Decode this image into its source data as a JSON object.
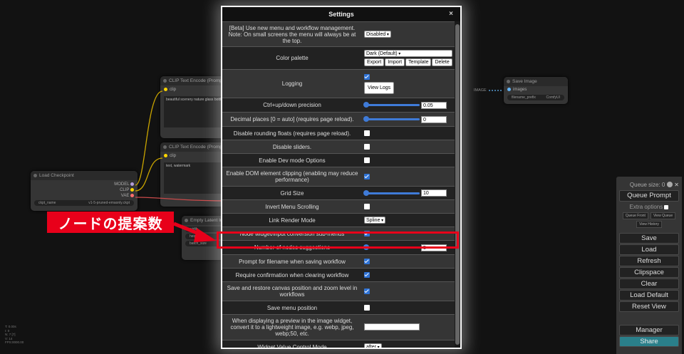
{
  "modal": {
    "title": "Settings",
    "close": "×"
  },
  "settings": [
    {
      "label": "[Beta] Use new menu and workflow management. Note: On small screens the menu will always be at the top.",
      "type": "select",
      "value": "Disabled"
    },
    {
      "label": "Color palette",
      "type": "palette",
      "value": "Dark (Default)",
      "buttons": [
        "Export",
        "Import",
        "Template",
        "Delete"
      ]
    },
    {
      "label": "Logging",
      "type": "logging",
      "checked": true,
      "button": "View Logs"
    },
    {
      "label": "Ctrl+up/down precision",
      "type": "slider",
      "value": "0.05"
    },
    {
      "label": "Decimal places [0 = auto] (requires page reload).",
      "type": "slider",
      "value": "0"
    },
    {
      "label": "Disable rounding floats (requires page reload).",
      "type": "checkbox",
      "checked": false
    },
    {
      "label": "Disable sliders.",
      "type": "checkbox",
      "checked": false
    },
    {
      "label": "Enable Dev mode Options",
      "type": "checkbox",
      "checked": false
    },
    {
      "label": "Enable DOM element clipping (enabling may reduce performance)",
      "type": "checkbox",
      "checked": true
    },
    {
      "label": "Grid Size",
      "type": "slider",
      "value": "10"
    },
    {
      "label": "Invert Menu Scrolling",
      "type": "checkbox",
      "checked": false
    },
    {
      "label": "Link Render Mode",
      "type": "select",
      "value": "Spline"
    },
    {
      "label": "Node widget/input conversion sub-menus",
      "type": "checkbox",
      "checked": true
    },
    {
      "label": "Number of nodes suggestions",
      "type": "slider",
      "value": "5"
    },
    {
      "label": "Prompt for filename when saving workflow",
      "type": "checkbox",
      "checked": true
    },
    {
      "label": "Require confirmation when clearing workflow",
      "type": "checkbox",
      "checked": true
    },
    {
      "label": "Save and restore canvas position and zoom level in workflows",
      "type": "checkbox",
      "checked": true
    },
    {
      "label": "Save menu position",
      "type": "checkbox",
      "checked": false
    },
    {
      "label": "When displaying a preview in the image widget, convert it to a lightweight image, e.g. webp, jpeg, webp;50, etc.",
      "type": "text",
      "value": ""
    },
    {
      "label": "Widget Value Control Mode",
      "type": "select",
      "value": "after"
    }
  ],
  "annotation": {
    "label": "ノードの提案数"
  },
  "menu": {
    "queue_size": "Queue size: 0",
    "queue_prompt": "Queue Prompt",
    "extra_options": "Extra options",
    "queue_front": "Queue Front",
    "view_queue": "View Queue",
    "view_history": "View History",
    "save": "Save",
    "load": "Load",
    "refresh": "Refresh",
    "clipspace": "Clipspace",
    "clear": "Clear",
    "load_default": "Load Default",
    "reset_view": "Reset View",
    "manager": "Manager",
    "share": "Share"
  },
  "nodes": {
    "clip1_title": "CLIP Text Encode (Prompt)",
    "clip1_input": "clip",
    "clip1_text": "beautiful scenery nature glass bottle",
    "clip2_title": "CLIP Text Encode (Prompt)",
    "clip2_input": "clip",
    "clip2_text": "text, watermark",
    "checkpoint_title": "Load Checkpoint",
    "checkpoint_out1": "MODEL",
    "checkpoint_out2": "CLIP",
    "checkpoint_out3": "VAE",
    "checkpoint_widget_label": "ckpt_name",
    "checkpoint_widget_value": "v1-5-pruned-emaonly.ckpt",
    "latent_title": "Empty Latent Image",
    "latent_w1": "width",
    "latent_w2": "height",
    "latent_w3": "batch_size",
    "save_title": "Save Image",
    "save_input": "images",
    "save_widget_label": "filename_prefix",
    "save_widget_value": "ComfyUI",
    "image_label": "IMAGE"
  },
  "stats": [
    "T: 0.00s",
    "I: 0",
    "N: 7 [7]",
    "V: 14",
    "FPS:0000.00"
  ],
  "colors": {
    "highlight": "#e8001a",
    "accent": "#3f7bd8"
  }
}
